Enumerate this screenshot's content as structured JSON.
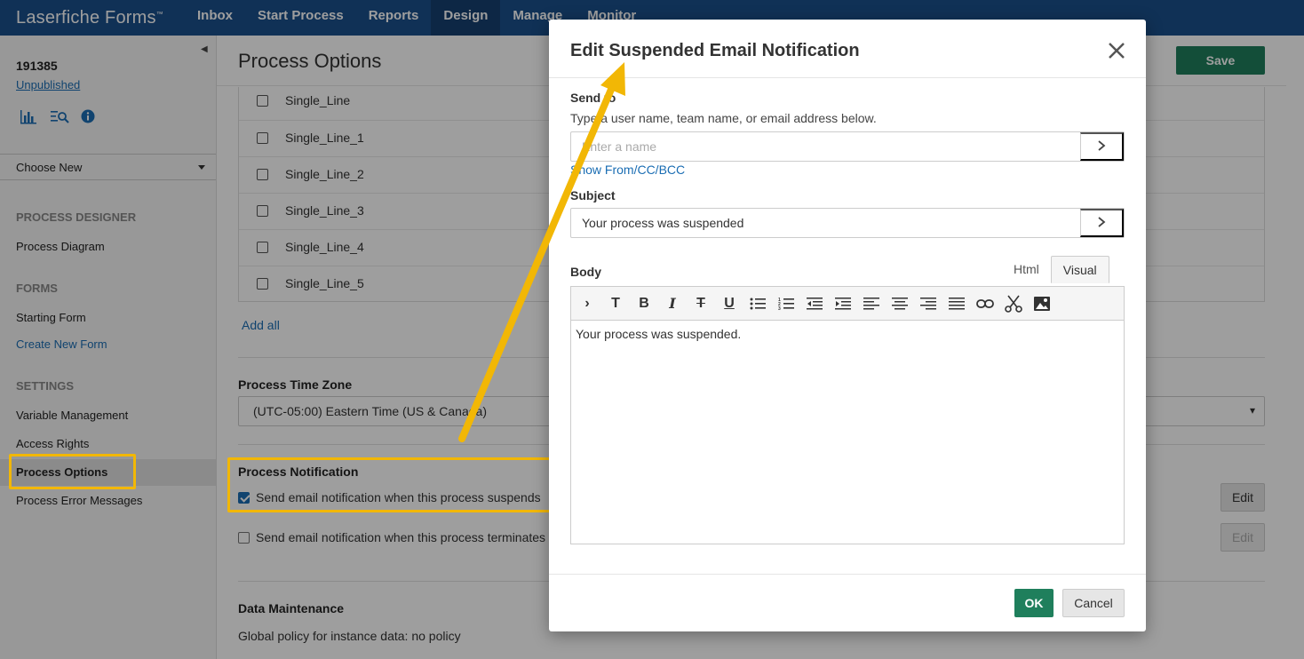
{
  "app": {
    "brand": "Laserfiche Forms",
    "brand_tm": "™",
    "nav": [
      "Inbox",
      "Start Process",
      "Reports",
      "Design",
      "Manage",
      "Monitor"
    ],
    "active_nav": "Design"
  },
  "sidebar": {
    "process_id": "191385",
    "status_link": "Unpublished",
    "choose_new": "Choose New",
    "sections": {
      "designer_head": "PROCESS DESIGNER",
      "designer_items": [
        "Process Diagram"
      ],
      "forms_head": "FORMS",
      "forms_items": [
        "Starting Form",
        "Create New Form"
      ],
      "settings_head": "SETTINGS",
      "settings_items": [
        "Variable Management",
        "Access Rights",
        "Process Options",
        "Process Error Messages"
      ]
    }
  },
  "main": {
    "title": "Process Options",
    "save_label": "Save",
    "variables": [
      "Single_Line",
      "Single_Line_1",
      "Single_Line_2",
      "Single_Line_3",
      "Single_Line_4",
      "Single_Line_5"
    ],
    "add_all": "Add all",
    "timezone_label": "Process Time Zone",
    "timezone_value": "(UTC-05:00) Eastern Time (US & Canada)",
    "notification_label": "Process Notification",
    "notify_suspend": "Send email notification when this process suspends",
    "notify_terminate": "Send email notification when this process terminates",
    "edit_label": "Edit",
    "maintenance_label": "Data Maintenance",
    "maintenance_text": "Global policy for instance data: no policy"
  },
  "modal": {
    "title": "Edit Suspended Email Notification",
    "send_to_label": "Send to",
    "send_to_help": "Type a user name, team name, or email address below.",
    "send_to_placeholder": "Enter a name",
    "show_cc_link": "Show From/CC/BCC",
    "subject_label": "Subject",
    "subject_value": "Your process was suspended",
    "body_label": "Body",
    "tab_html": "Html",
    "tab_visual": "Visual",
    "body_text": "Your process was suspended.",
    "ok_label": "OK",
    "cancel_label": "Cancel"
  },
  "colors": {
    "nav_bg": "#1a4f8c",
    "primary_green": "#1f7f5c",
    "link_blue": "#1a6db3",
    "annotation_yellow": "#f2b705"
  }
}
